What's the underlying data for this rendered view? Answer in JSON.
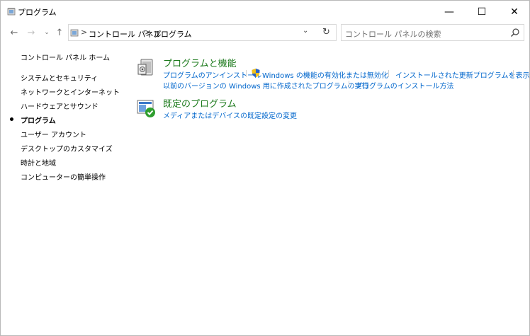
{
  "window": {
    "title": "プログラム",
    "icon": "control-panel-icon",
    "controls": {
      "minimize": "—",
      "maximize": "☐",
      "close": "✕"
    }
  },
  "nav": {
    "back": "←",
    "forward": "→",
    "recent": "⌄",
    "up": "↑",
    "breadcrumb": [
      "コントロール パネル",
      "プログラム"
    ],
    "separator": ">",
    "dropdown": "⌄",
    "refresh": "↻"
  },
  "search": {
    "placeholder": "コントロール パネルの検索"
  },
  "sidebar": {
    "items": [
      {
        "label": "コントロール パネル ホーム"
      },
      {
        "label": "システムとセキュリティ"
      },
      {
        "label": "ネットワークとインターネット"
      },
      {
        "label": "ハードウェアとサウンド"
      },
      {
        "label": "プログラム",
        "active": true
      },
      {
        "label": "ユーザー アカウント"
      },
      {
        "label": "デスクトップのカスタマイズ"
      },
      {
        "label": "時計と地域"
      },
      {
        "label": "コンピューターの簡単操作"
      }
    ]
  },
  "categories": [
    {
      "title": "プログラムと機能",
      "icon": "programs-features-icon",
      "tasks": [
        {
          "label": "プログラムのアンインストール"
        },
        {
          "label": "Windows の機能の有効化または無効化",
          "icon": "uac-shield-icon"
        },
        {
          "label": "インストールされた更新プログラムを表示"
        },
        {
          "label": "以前のバージョンの Windows 用に作成されたプログラムの実行"
        },
        {
          "label": "プログラムのインストール方法"
        }
      ]
    },
    {
      "title": "既定のプログラム",
      "icon": "default-programs-icon",
      "tasks": [
        {
          "label": "メディアまたはデバイスの既定設定の変更"
        }
      ]
    }
  ],
  "colors": {
    "category_title": "#1e7b1e",
    "link": "#0066cc"
  }
}
